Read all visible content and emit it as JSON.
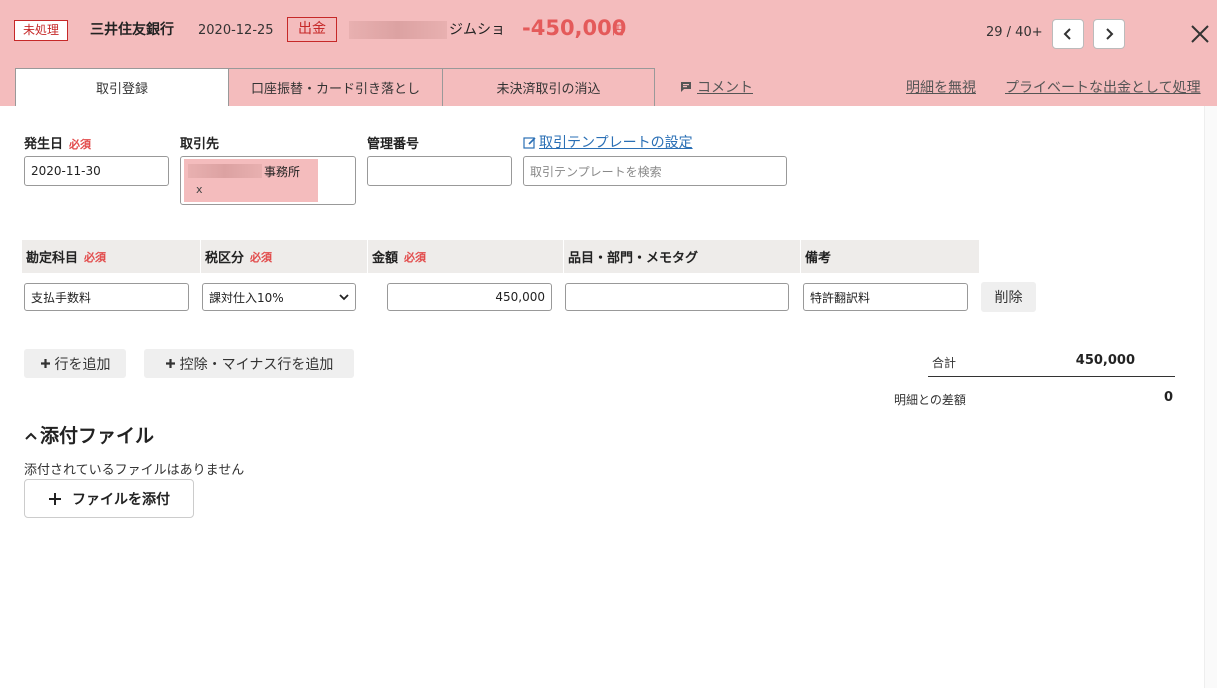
{
  "header": {
    "status": "未処理",
    "bank": "三井住友銀行",
    "date": "2020-12-25",
    "type": "出金",
    "payee_suffix": "ジムショ",
    "amount": "-450,000",
    "currency": "円",
    "pager": "29 / 40+"
  },
  "tabs": [
    "取引登録",
    "口座振替・カード引き落とし",
    "未決済取引の消込"
  ],
  "header_links": {
    "comment": "コメント",
    "ignore": "明細を無視",
    "private": "プライベートな出金として処理"
  },
  "form": {
    "date_label": "発生日",
    "required": "必須",
    "date_value": "2020-11-30",
    "partner_label": "取引先",
    "partner_tag": "事務所",
    "partner_remove": "x",
    "mgmt_label": "管理番号",
    "mgmt_value": "",
    "template_link": "取引テンプレートの設定",
    "template_placeholder": "取引テンプレートを検索"
  },
  "table": {
    "headers": [
      "勘定科目",
      "税区分",
      "金額",
      "品目・部門・メモタグ",
      "備考"
    ],
    "row": {
      "account": "支払手数料",
      "tax": "課対仕入10%",
      "amount": "450,000",
      "tags": "",
      "note": "特許翻訳料",
      "delete": "削除"
    }
  },
  "actions": {
    "add_row": "行を追加",
    "add_minus": "控除・マイナス行を追加"
  },
  "summary": {
    "total_label": "合計",
    "total_value": "450,000",
    "diff_label": "明細との差額",
    "diff_value": "0"
  },
  "attachments": {
    "title": "添付ファイル",
    "empty": "添付されているファイルはありません",
    "add": "ファイルを添付"
  },
  "colors": {
    "header_bg": "#f4bcbd",
    "accent_red": "#e45a5a",
    "link": "#2a6fb5"
  }
}
